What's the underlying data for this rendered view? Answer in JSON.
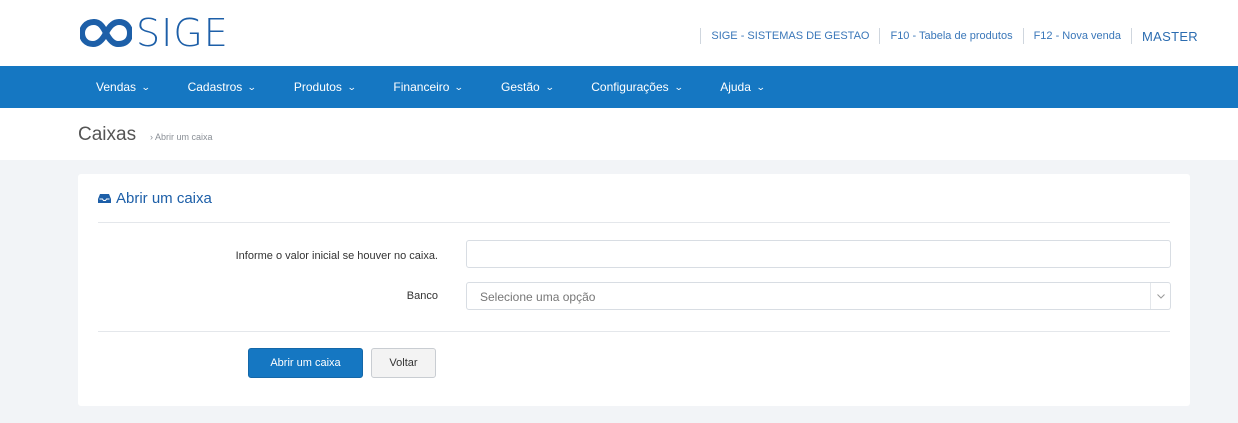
{
  "brand": {
    "logo_text": "SIGE",
    "logo_icon": "infinity-logo-icon"
  },
  "toplinks": {
    "company": "SIGE - SISTEMAS DE GESTAO",
    "products_shortcut": "F10 - Tabela de produtos",
    "sale_shortcut": "F12 - Nova venda",
    "user": "MASTER"
  },
  "nav": {
    "items": [
      {
        "label": "Vendas"
      },
      {
        "label": "Cadastros"
      },
      {
        "label": "Produtos"
      },
      {
        "label": "Financeiro"
      },
      {
        "label": "Gestão"
      },
      {
        "label": "Configurações"
      },
      {
        "label": "Ajuda"
      }
    ],
    "chevron": "chevron-down-icon"
  },
  "breadcrumb": {
    "title": "Caixas",
    "separator": "›",
    "current": "Abrir um caixa"
  },
  "panel": {
    "title": "Abrir um caixa",
    "title_icon": "inbox-icon",
    "fields": {
      "initial_value_label": "Informe o valor inicial se houver no caixa.",
      "initial_value": "",
      "bank_label": "Banco",
      "bank_placeholder": "Selecione uma opção"
    },
    "buttons": {
      "submit": "Abrir um caixa",
      "back": "Voltar"
    }
  },
  "colors": {
    "brand_blue": "#1577c2",
    "logo_blue": "#1d5fa8",
    "page_bg": "#f2f4f7"
  }
}
